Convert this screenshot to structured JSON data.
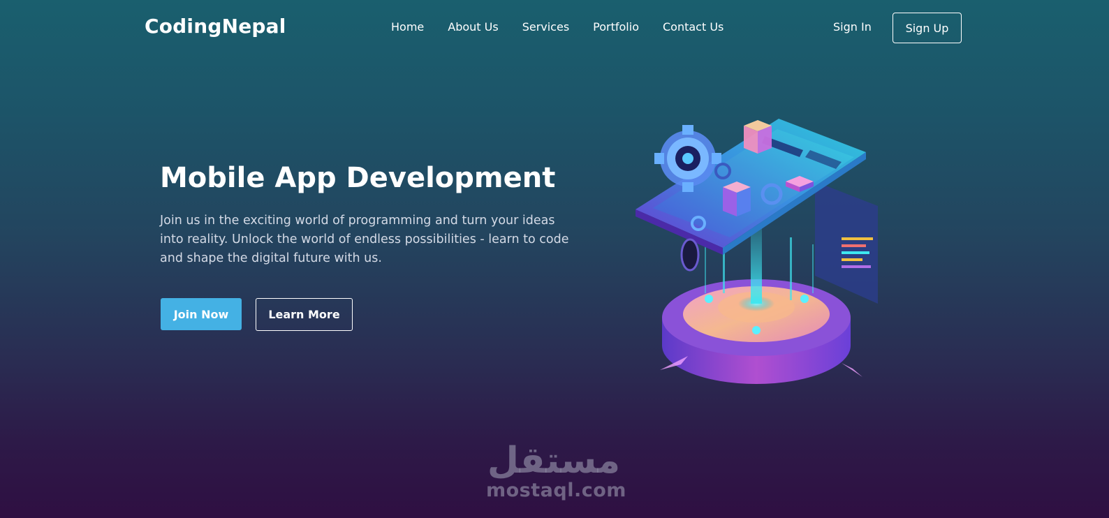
{
  "header": {
    "logo": "CodingNepal",
    "nav": [
      {
        "label": "Home"
      },
      {
        "label": "About Us"
      },
      {
        "label": "Services"
      },
      {
        "label": "Portfolio"
      },
      {
        "label": "Contact Us"
      }
    ],
    "sign_in": "Sign In",
    "sign_up": "Sign Up"
  },
  "hero": {
    "title": "Mobile App Development",
    "description": "Join us in the exciting world of programming and turn your ideas into reality. Unlock the world of endless possibilities - learn to code and shape the digital future with us.",
    "primary_button": "Join Now",
    "secondary_button": "Learn More"
  },
  "illustration": {
    "icon": "isometric-phone-gears-illustration"
  },
  "watermark": {
    "arabic": "مستقل",
    "latin": "mostaql.com"
  },
  "colors": {
    "accent": "#44b1e4",
    "bg_top": "#1a5f6e",
    "bg_bottom": "#2f0f42",
    "text": "#ffffff",
    "text_muted": "#d4dae6"
  }
}
